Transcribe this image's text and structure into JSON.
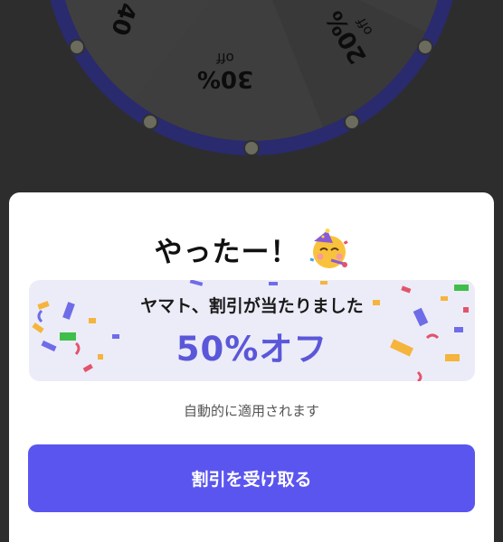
{
  "wheel": {
    "segments": [
      {
        "label": "40",
        "unit": ""
      },
      {
        "label": "30%",
        "unit": "off"
      },
      {
        "label": "20%",
        "unit": "off"
      }
    ],
    "rim_color": "#2a2a6e",
    "bulb_color": "#6b6b5e"
  },
  "dialog": {
    "title": "やったー！",
    "title_icon": "partying-face-icon",
    "prize": {
      "heading": "ヤマト、割引が当たりました",
      "value": "50%オフ",
      "accent": "#5b57d9",
      "background": "#ececf8"
    },
    "note": "自動的に適用されます",
    "claim_button_label": "割引を受け取る",
    "button_color": "#5b55f0"
  }
}
